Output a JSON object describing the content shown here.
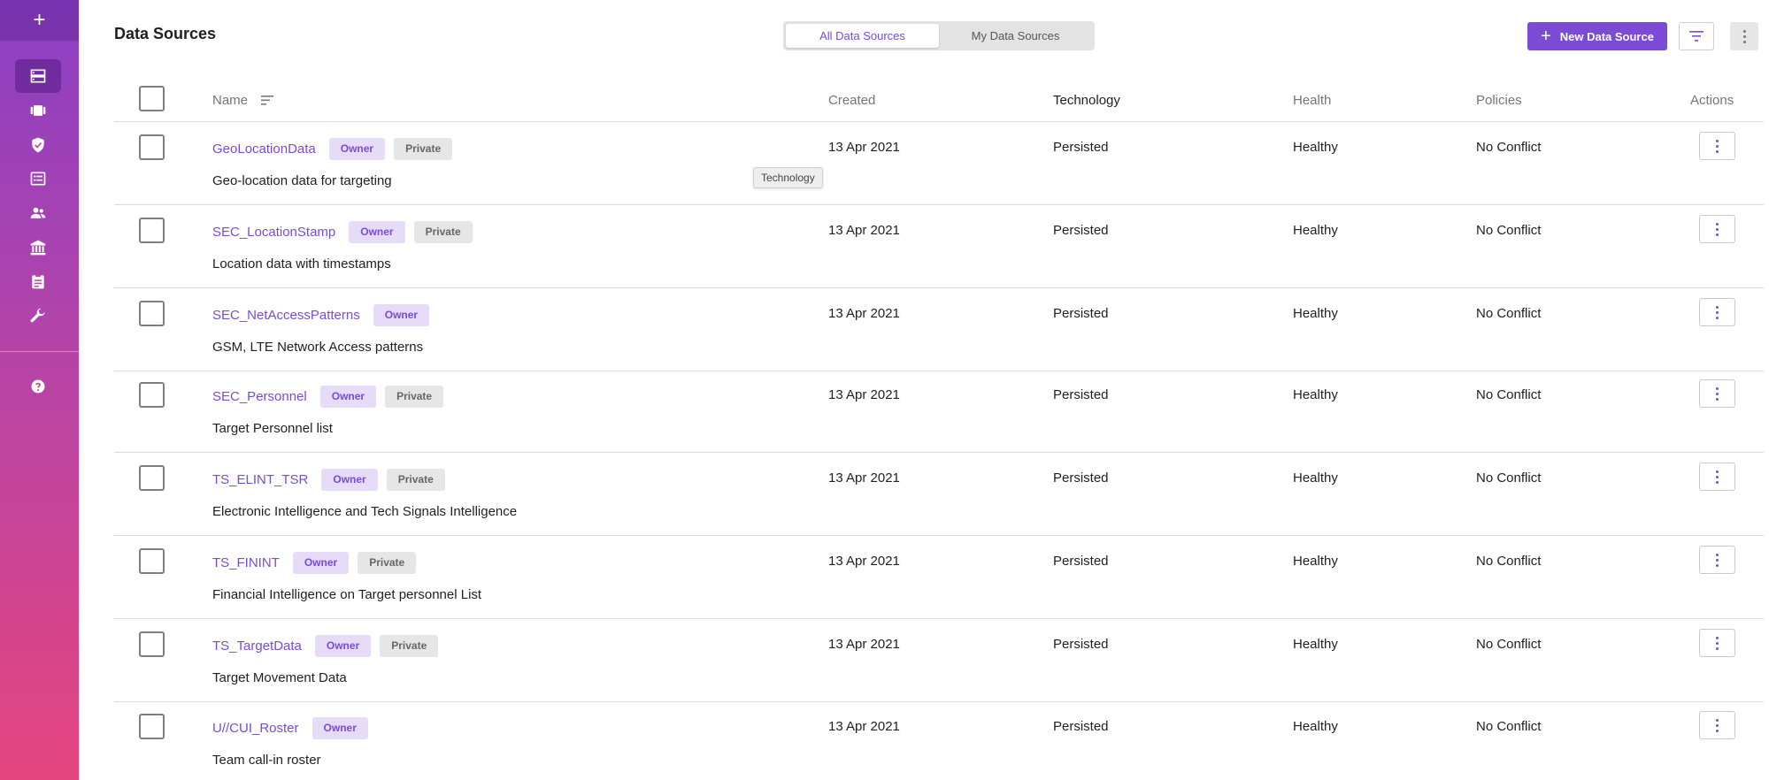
{
  "header": {
    "title": "Data Sources",
    "tabs": [
      {
        "label": "All Data Sources",
        "active": true
      },
      {
        "label": "My Data Sources",
        "active": false
      }
    ],
    "new_button": "New Data Source"
  },
  "sidebar": {
    "items": [
      {
        "icon": "data-sources-icon",
        "active": true
      },
      {
        "icon": "datasets-icon",
        "active": false
      },
      {
        "icon": "shield-icon",
        "active": false
      },
      {
        "icon": "list-card-icon",
        "active": false
      },
      {
        "icon": "users-icon",
        "active": false
      },
      {
        "icon": "institution-icon",
        "active": false
      },
      {
        "icon": "clipboard-icon",
        "active": false
      },
      {
        "icon": "wrench-icon",
        "active": false
      }
    ],
    "help_icon": "help-icon"
  },
  "table": {
    "columns": {
      "name": "Name",
      "created": "Created",
      "technology": "Technology",
      "health": "Health",
      "policies": "Policies",
      "actions": "Actions"
    },
    "rows": [
      {
        "name": "GeoLocationData",
        "owner": "Owner",
        "private": "Private",
        "description": "Geo-location data for targeting",
        "created": "13 Apr 2021",
        "technology": "Persisted",
        "health": "Healthy",
        "policies": "No Conflict"
      },
      {
        "name": "SEC_LocationStamp",
        "owner": "Owner",
        "private": "Private",
        "description": "Location data with timestamps",
        "created": "13 Apr 2021",
        "technology": "Persisted",
        "health": "Healthy",
        "policies": "No Conflict"
      },
      {
        "name": "SEC_NetAccessPatterns",
        "owner": "Owner",
        "private": "",
        "description": "GSM, LTE Network Access patterns",
        "created": "13 Apr 2021",
        "technology": "Persisted",
        "health": "Healthy",
        "policies": "No Conflict"
      },
      {
        "name": "SEC_Personnel",
        "owner": "Owner",
        "private": "Private",
        "description": "Target Personnel list",
        "created": "13 Apr 2021",
        "technology": "Persisted",
        "health": "Healthy",
        "policies": "No Conflict"
      },
      {
        "name": "TS_ELINT_TSR",
        "owner": "Owner",
        "private": "Private",
        "description": "Electronic Intelligence and Tech Signals Intelligence",
        "created": "13 Apr 2021",
        "technology": "Persisted",
        "health": "Healthy",
        "policies": "No Conflict"
      },
      {
        "name": "TS_FININT",
        "owner": "Owner",
        "private": "Private",
        "description": "Financial Intelligence on Target personnel List",
        "created": "13 Apr 2021",
        "technology": "Persisted",
        "health": "Healthy",
        "policies": "No Conflict"
      },
      {
        "name": "TS_TargetData",
        "owner": "Owner",
        "private": "Private",
        "description": "Target Movement Data",
        "created": "13 Apr 2021",
        "technology": "Persisted",
        "health": "Healthy",
        "policies": "No Conflict"
      },
      {
        "name": "U//CUI_Roster",
        "owner": "Owner",
        "private": "",
        "description": "Team call-in roster",
        "created": "13 Apr 2021",
        "technology": "Persisted",
        "health": "Healthy",
        "policies": "No Conflict"
      }
    ]
  },
  "tooltip": "Technology",
  "colors": {
    "accent": "#7b4bd6",
    "sidebar_top": "#8a3fc4",
    "sidebar_bottom": "#e5457e"
  }
}
